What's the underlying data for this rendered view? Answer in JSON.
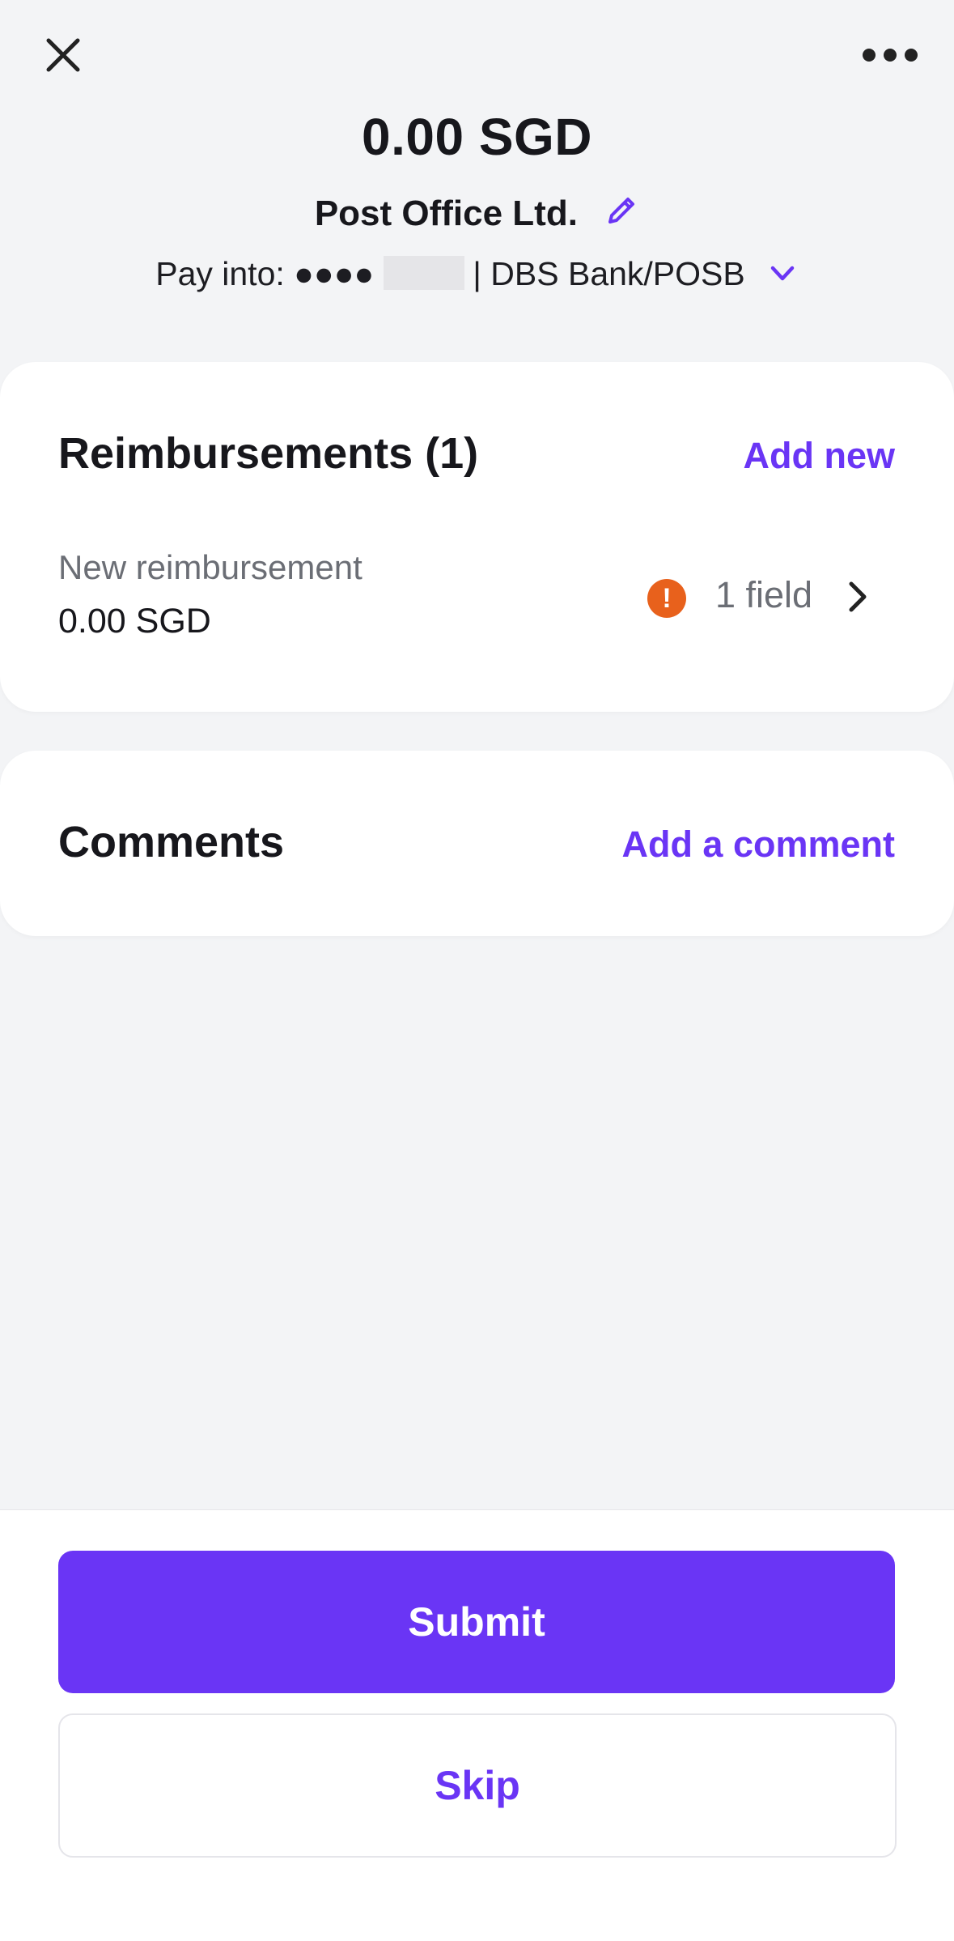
{
  "header": {
    "close_icon": "close-icon",
    "more_icon": "more-horizontal-icon",
    "amount": "0.00 SGD",
    "payee": "Post Office Ltd.",
    "edit_icon": "pencil-icon",
    "pay_into_label": "Pay into: ",
    "masked_account": "●●●●",
    "bank": "| DBS Bank/POSB",
    "chevron_icon": "chevron-down-icon"
  },
  "reimbursements": {
    "title": "Reimbursements (1)",
    "add_label": "Add new",
    "items": [
      {
        "name": "New reimbursement",
        "amount": "0.00 SGD",
        "warning_glyph": "!",
        "status": "1 field"
      }
    ]
  },
  "comments": {
    "title": "Comments",
    "add_label": "Add a comment"
  },
  "actions": {
    "submit_label": "Submit",
    "skip_label": "Skip"
  },
  "colors": {
    "accent": "#6a35f5",
    "warning": "#e8611c",
    "background": "#f3f4f6",
    "text": "#17171c",
    "muted": "#6b6e75"
  }
}
